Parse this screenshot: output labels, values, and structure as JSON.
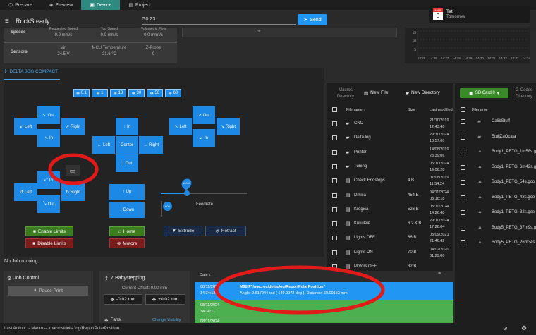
{
  "tabs": [
    {
      "label": "Prepare"
    },
    {
      "label": "Preview"
    },
    {
      "label": "Device"
    },
    {
      "label": "Project"
    }
  ],
  "header": {
    "app_name": "RockSteady",
    "gcode_value": "G0 Z3",
    "send_label": "Send"
  },
  "notification": {
    "calendar_month": "MAR",
    "calendar_day": "9",
    "title": "Tati",
    "subtitle": "Tomorrow"
  },
  "machine": {
    "speeds_label": "Speeds",
    "sensors_label": "Sensors",
    "speed_cols": [
      {
        "label": "Requested Speed",
        "value": "0.0 mm/s"
      },
      {
        "label": "Top Speed",
        "value": "0.0 mm/s"
      },
      {
        "label": "Volumetric Flow",
        "value": "0.0 mm³/s"
      }
    ],
    "sensor_cols": [
      {
        "label": "Vin",
        "value": "24.5 V"
      },
      {
        "label": "MCU Temperature",
        "value": "21.6 °C"
      },
      {
        "label": "Z-Probe",
        "value": "0"
      }
    ]
  },
  "center_top": {
    "label": "off"
  },
  "graph": {
    "ticks": [
      "14:25",
      "14:26",
      "14:27",
      "14:28",
      "14:29",
      "14:30",
      "14:31",
      "14:32",
      "14:33",
      "14:34"
    ],
    "y_labels": [
      "15",
      "10",
      "5",
      "0"
    ]
  },
  "jog": {
    "title": "DELTA JOG COMPACT",
    "steps": [
      "0.1",
      "1",
      "10",
      "30",
      "50",
      "60"
    ],
    "out": "Out",
    "in": "In",
    "left": "Left",
    "right": "Right",
    "up": "Up",
    "down": "Down",
    "center": "Center",
    "enable_limits": "Enable Limits",
    "disable_limits": "Disable Limits",
    "home": "Home",
    "motors": "Motors",
    "feedrate": "Feedrate",
    "slider_top": "10000",
    "slider_bottom": "600",
    "extrude": "Extrude",
    "retract": "Retract"
  },
  "files": {
    "tab_macros": "Macros",
    "tab_directory": "Directory",
    "new_file": "New File",
    "new_directory": "New Directory",
    "col_name": "Filename",
    "col_size": "Size",
    "col_modified": "Last modified",
    "rows": [
      {
        "name": "CNC",
        "size": "",
        "date": "21/10/2019",
        "time": "12:43:40"
      },
      {
        "name": "DeltaJog",
        "size": "",
        "date": "29/10/2024",
        "time": "13:57:00"
      },
      {
        "name": "Printer",
        "size": "",
        "date": "14/08/2019",
        "time": "23:39:06"
      },
      {
        "name": "Tuning",
        "size": "",
        "date": "05/10/2024",
        "time": "19:06:28"
      },
      {
        "name": "Check Endstops",
        "size": "4 B",
        "date": "07/08/2019",
        "time": "11:54:24"
      },
      {
        "name": "Drkica",
        "size": "454 B",
        "date": "04/11/2024",
        "time": "03:16:18"
      },
      {
        "name": "Krogica",
        "size": "526 B",
        "date": "03/11/2024",
        "time": "14:26:40"
      },
      {
        "name": "Kukulele",
        "size": "6.2 KiB",
        "date": "29/10/2024",
        "time": "17:26:04"
      },
      {
        "name": "Lights OFF",
        "size": "66 B",
        "date": "03/09/2021",
        "time": "21:46:42"
      },
      {
        "name": "Lights ON",
        "size": "70 B",
        "date": "04/02/2020",
        "time": "01:29:00"
      },
      {
        "name": "Motors OFF",
        "size": "32 B",
        "date": "",
        "time": ""
      }
    ]
  },
  "sd": {
    "button": "SD Card 0",
    "tab_gcodes": "G-Codes",
    "tab_directory": "Directory",
    "col_name": "Filename",
    "rows": [
      "CalibStuff",
      "EtuijZaOcala",
      "Body1_PETG_1m58s.g",
      "Body1_PETG_6m42s.g",
      "Body1_PETG_54s.gco",
      "Body1_PETG_48s.gco",
      "Body1_PETG_32s.gco",
      "Body5_PETG_37m9s.g",
      "Body5_PETG_26m34s"
    ]
  },
  "status": {
    "text": "No Job running."
  },
  "job": {
    "title": "Job Control",
    "pause": "Pause Print"
  },
  "baby": {
    "title": "Z Babystepping",
    "offset": "Current Offset: 0.00 mm",
    "minus": "-0.02 mm",
    "plus": "+0.02 mm"
  },
  "fans": {
    "title": "Fans",
    "change": "Change Visibility"
  },
  "console": {
    "col_date": "Date",
    "entries": [
      {
        "date": "08/11/2024",
        "time": "14:34:12",
        "cmd": "M98 P\"/macros/deltaJog/ReportPolarPosition\"",
        "msg": "Angle: 2.617944 rad ( 149.9972 deg ), Distance: 50.00153 mm"
      },
      {
        "date": "08/11/2024",
        "time": "14:34:11",
        "cmd": "",
        "msg": ""
      },
      {
        "date": "08/11/2024",
        "time": "",
        "cmd": "",
        "msg": ""
      }
    ]
  },
  "footer": {
    "last_action": "Last Action: -- Macro -- /macros/deltaJog/ReportPolarPosition"
  },
  "colors": {
    "accent": "#2196f3",
    "tab_active": "#2e8a80",
    "jog_blue": "#1e88e5",
    "green": "#3b7d1f",
    "red_annot": "#e11a1a"
  }
}
